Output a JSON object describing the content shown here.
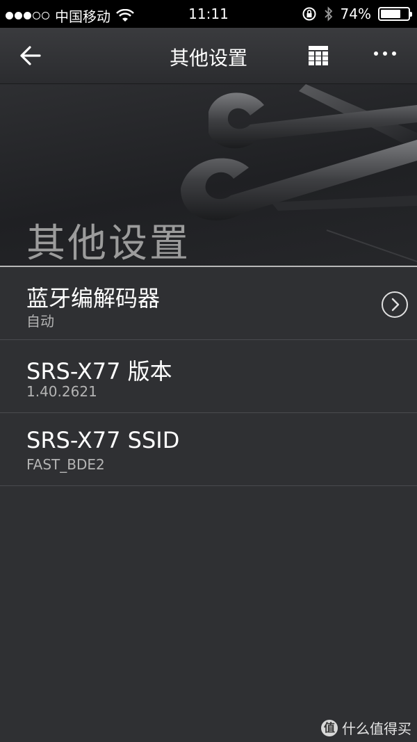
{
  "status_bar": {
    "carrier": "中国移动",
    "time": "11:11",
    "battery_percent": "74%",
    "battery_level": 0.74
  },
  "nav": {
    "title": "其他设置"
  },
  "hero": {
    "title": "其他设置"
  },
  "items": [
    {
      "title": "蓝牙编解码器",
      "subtitle": "自动"
    },
    {
      "title": "SRS-X77 版本",
      "subtitle": "1.40.2621"
    },
    {
      "title": "SRS-X77 SSID",
      "subtitle": "FAST_BDE2"
    }
  ],
  "watermark": {
    "text": "什么值得买",
    "logo": "值"
  }
}
